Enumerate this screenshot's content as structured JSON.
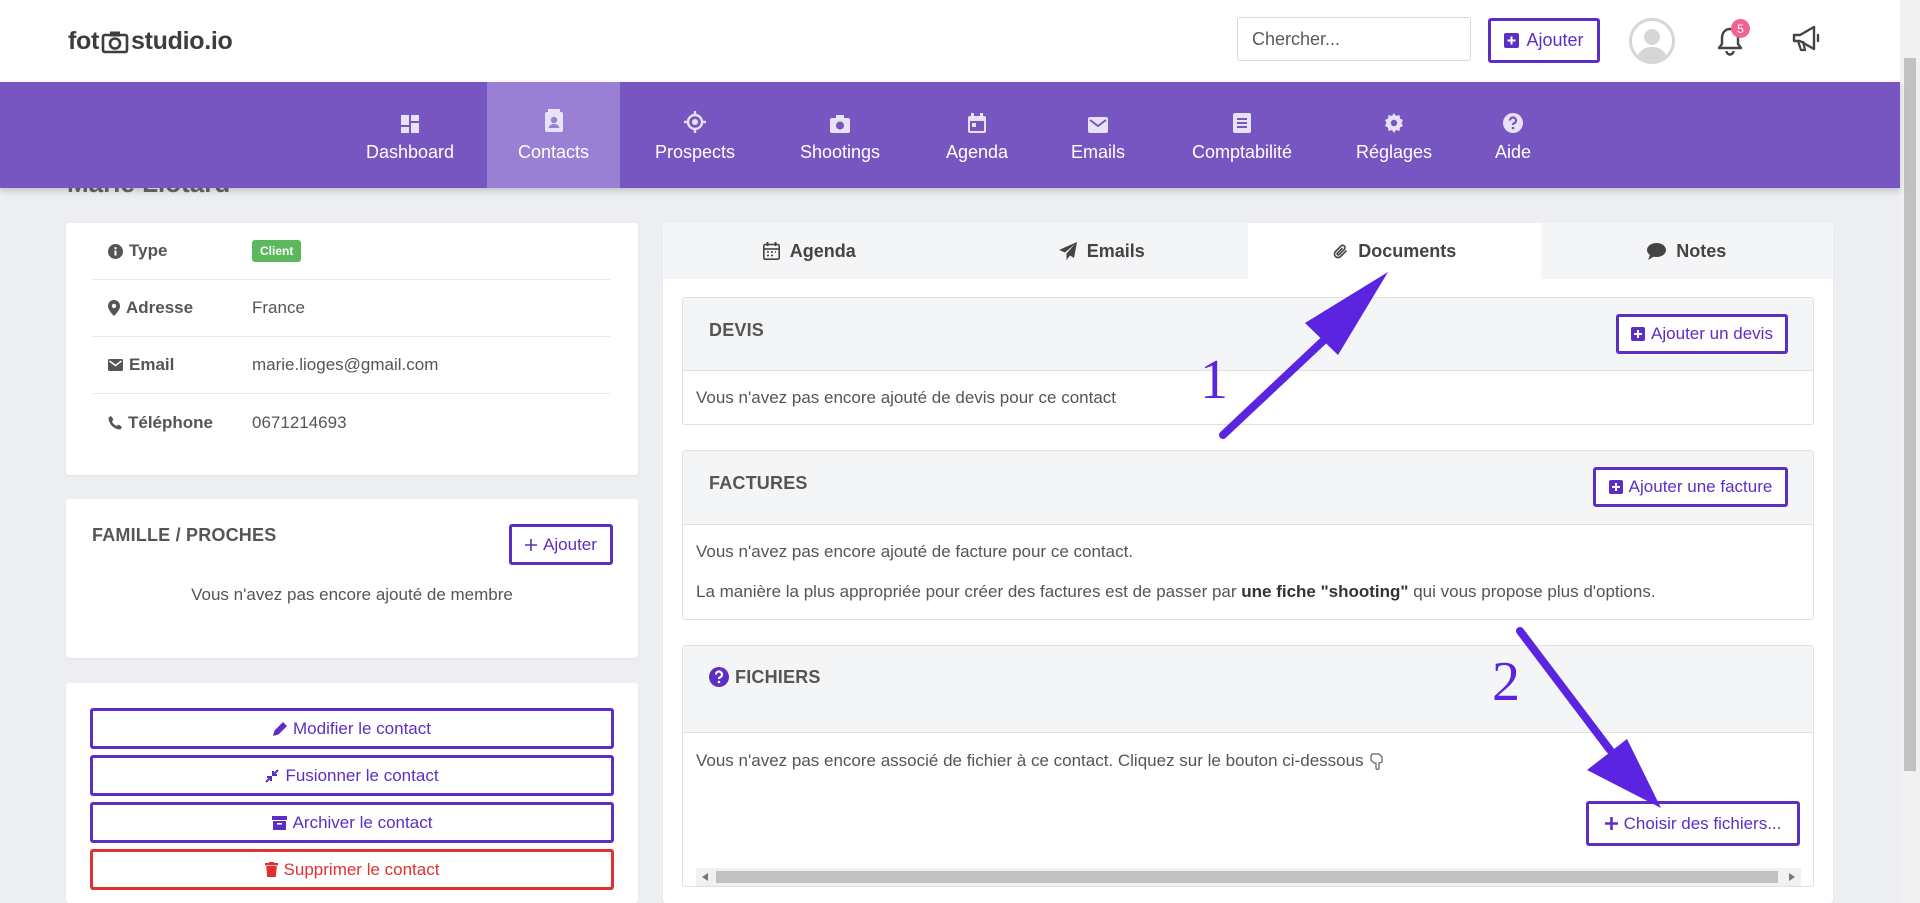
{
  "header": {
    "logo_left": "fot",
    "logo_right": "studio.io",
    "search_placeholder": "Chercher...",
    "add_label": "Ajouter",
    "notifications_count": "5"
  },
  "nav": [
    {
      "label": "Dashboard",
      "icon": "dashboard-icon"
    },
    {
      "label": "Contacts",
      "icon": "contact-card-icon",
      "active": true
    },
    {
      "label": "Prospects",
      "icon": "target-icon"
    },
    {
      "label": "Shootings",
      "icon": "camera-icon"
    },
    {
      "label": "Agenda",
      "icon": "calendar-icon"
    },
    {
      "label": "Emails",
      "icon": "envelope-icon"
    },
    {
      "label": "Comptabilité",
      "icon": "document-icon"
    },
    {
      "label": "Réglages",
      "icon": "gear-icon"
    },
    {
      "label": "Aide",
      "icon": "question-icon"
    }
  ],
  "contact": {
    "partial_title": "Marie Liotard",
    "type_label": "Type",
    "type_value": "Client",
    "address_label": "Adresse",
    "address_value": "France",
    "email_label": "Email",
    "email_value": "marie.lioges@gmail.com",
    "phone_label": "Téléphone",
    "phone_value": "0671214693"
  },
  "family": {
    "title": "FAMILLE / PROCHES",
    "add_label": "Ajouter",
    "empty_text": "Vous n'avez pas encore ajouté de membre"
  },
  "actions": {
    "edit": "Modifier le contact",
    "merge": "Fusionner le contact",
    "archive": "Archiver le contact",
    "delete": "Supprimer le contact"
  },
  "tabs": [
    {
      "label": "Agenda",
      "icon": "calendar-icon"
    },
    {
      "label": "Emails",
      "icon": "paper-plane-icon"
    },
    {
      "label": "Documents",
      "icon": "paperclip-icon",
      "active": true
    },
    {
      "label": "Notes",
      "icon": "comment-icon"
    }
  ],
  "devis": {
    "title": "DEVIS",
    "add_label": "Ajouter un devis",
    "empty_text": "Vous n'avez pas encore ajouté de devis pour ce contact"
  },
  "factures": {
    "title": "FACTURES",
    "add_label": "Ajouter une facture",
    "empty_text": "Vous n'avez pas encore ajouté de facture pour ce contact.",
    "hint_before": "La manière la plus appropriée pour créer des factures est de passer par ",
    "hint_bold": "une fiche \"shooting\"",
    "hint_after": " qui vous propose plus d'options."
  },
  "fichiers": {
    "title": "FICHIERS",
    "empty_text": "Vous n'avez pas encore associé de fichier à ce contact. Cliquez sur le bouton ci-dessous",
    "choose_label": "Choisir des fichiers..."
  },
  "annotations": {
    "one": "1",
    "two": "2"
  },
  "colors": {
    "brand_purple": "#7856c1",
    "accent": "#5c2fc2",
    "danger": "#e03131",
    "client_badge": "#5cb85c",
    "annotation_arrow": "#5a24e0"
  }
}
